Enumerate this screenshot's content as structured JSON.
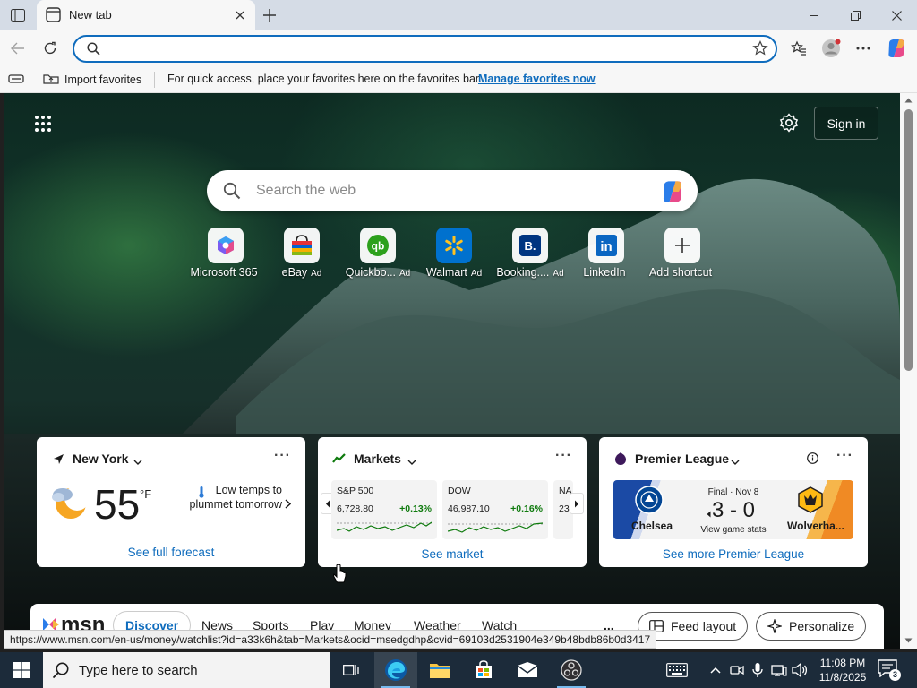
{
  "browser": {
    "tab_title": "New tab",
    "address_placeholder": "",
    "favbar": {
      "import_label": "Import favorites",
      "message": "For quick access, place your favorites here on the favorites bar.",
      "manage_link": "Manage favorites now"
    }
  },
  "ntp": {
    "sign_in": "Sign in",
    "search_placeholder": "Search the web",
    "shortcuts": [
      {
        "label": "Microsoft 365",
        "ad": "",
        "icon": "microsoft-365-icon"
      },
      {
        "label": "eBay",
        "ad": "Ad",
        "icon": "ebay-icon"
      },
      {
        "label": "Quickbo...",
        "ad": "Ad",
        "icon": "quickbooks-icon"
      },
      {
        "label": "Walmart",
        "ad": "Ad",
        "icon": "walmart-icon"
      },
      {
        "label": "Booking....",
        "ad": "Ad",
        "icon": "booking-icon"
      },
      {
        "label": "LinkedIn",
        "ad": "",
        "icon": "linkedin-icon"
      },
      {
        "label": "Add shortcut",
        "ad": "",
        "icon": "plus-icon"
      }
    ],
    "weather": {
      "location": "New York",
      "temperature": "55",
      "unit": "°F",
      "alert": "Low temps to plummet tomorrow",
      "link": "See full forecast"
    },
    "markets": {
      "title": "Markets",
      "stocks": [
        {
          "name": "S&P 500",
          "value": "6,728.80",
          "change": "+0.13%"
        },
        {
          "name": "DOW",
          "value": "46,987.10",
          "change": "+0.16%"
        },
        {
          "name": "NA",
          "value": "23",
          "change": ""
        }
      ],
      "link": "See market"
    },
    "sports": {
      "title": "Premier League",
      "status": "Final · Nov 8",
      "score": "3 - 0",
      "stats_link": "View game stats",
      "home_team": "Chelsea",
      "away_team": "Wolverha...",
      "link": "See more Premier League"
    },
    "feed": {
      "logo": "msn",
      "tabs": [
        "Discover",
        "News",
        "Sports",
        "Play",
        "Money",
        "Weather",
        "Watch"
      ],
      "more": "...",
      "feed_layout": "Feed layout",
      "personalize": "Personalize"
    },
    "status_url": "https://www.msn.com/en-us/money/watchlist?id=a33k6h&tab=Markets&ocid=msedgdhp&cvid=69103d2531904e349b48bdb86b0d3417"
  },
  "taskbar": {
    "search_placeholder": "Type here to search",
    "time": "11:08 PM",
    "date": "11/8/2025",
    "notification_count": "3"
  },
  "colors": {
    "accent": "#0f6cbd",
    "positive": "#0e7a0d",
    "taskbar": "#1c2b3a"
  }
}
